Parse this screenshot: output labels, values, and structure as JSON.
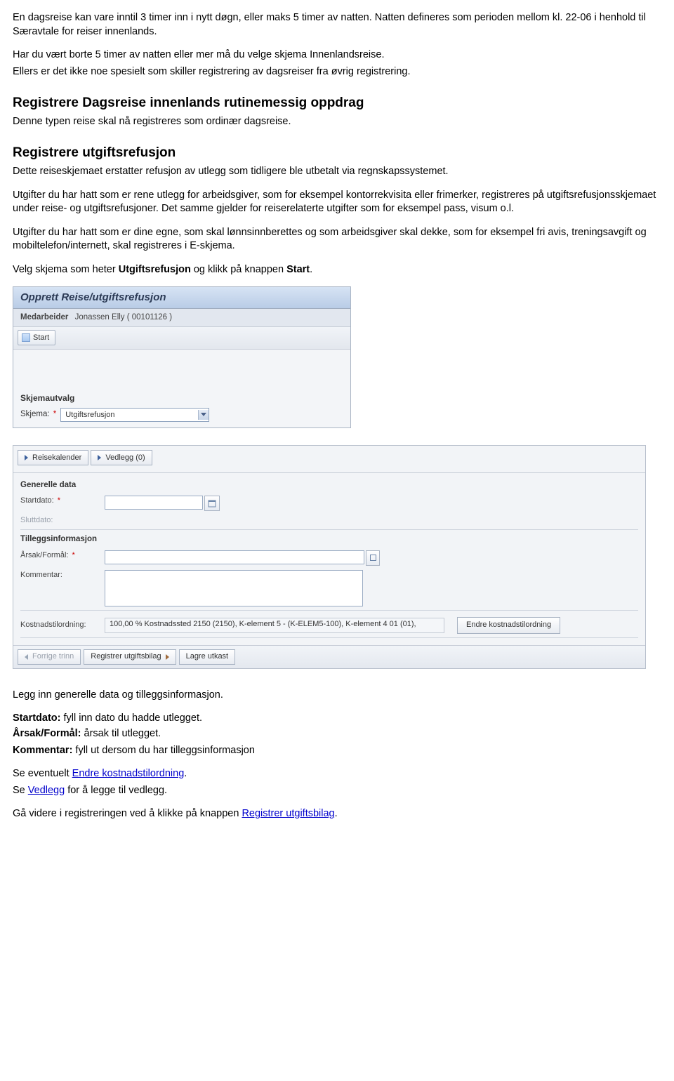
{
  "intro": {
    "p1": "En dagsreise kan vare inntil 3 timer inn i nytt døgn, eller maks 5 timer av natten. Natten defineres som perioden mellom kl. 22-06 i henhold til Særavtale for reiser innenlands.",
    "p2": "Har du vært borte 5 timer av natten eller mer må du velge skjema Innenlandsreise.",
    "p3": "Ellers er det ikke noe spesielt som skiller registrering av dagsreiser fra øvrig registrering."
  },
  "sec1": {
    "title": "Registrere Dagsreise innenlands rutinemessig oppdrag",
    "sub": "Denne typen reise skal nå registreres som ordinær dagsreise."
  },
  "sec2": {
    "title": "Registrere utgiftsrefusjon",
    "p1": "Dette reiseskjemaet erstatter refusjon av utlegg som tidligere ble utbetalt via regnskapssystemet.",
    "p2": "Utgifter du har hatt som er rene utlegg for arbeidsgiver, som for eksempel kontorrekvisita eller frimerker, registreres på utgiftsrefusjonsskjemaet under reise- og utgiftsrefusjoner. Det samme gjelder for reiserelaterte utgifter som for eksempel pass, visum o.l.",
    "p3": "Utgifter du har hatt som er dine egne, som skal lønnsinnberettes og som arbeidsgiver skal dekke, som for eksempel fri avis, treningsavgift og mobiltelefon/internett, skal registreres i E-skjema.",
    "p4_a": "Velg skjema som heter ",
    "p4_b": "Utgiftsrefusjon",
    "p4_c": " og klikk på knappen ",
    "p4_d": "Start",
    "p4_e": "."
  },
  "panel": {
    "title": "Opprett Reise/utgiftsrefusjon",
    "medarbeider_lbl": "Medarbeider",
    "medarbeider_val": "Jonassen Elly ( 00101126 )",
    "start_btn": "Start",
    "section_title": "Skjemautvalg",
    "skjema_lbl": "Skjema:",
    "skjema_val": "Utgiftsrefusjon"
  },
  "form": {
    "btn_reisekalender": "Reisekalender",
    "btn_vedlegg": "Vedlegg (0)",
    "generelle": "Generelle data",
    "startdato": "Startdato:",
    "sluttdato": "Sluttdato:",
    "tillegg": "Tilleggsinformasjon",
    "arsak": "Årsak/Formål:",
    "kommentar": "Kommentar:",
    "kostnad_lbl": "Kostnadstilordning:",
    "kostnad_val": "100,00 % Kostnadssted 2150 (2150), K-element 5 - (K-ELEM5-100), K-element 4 01 (01),",
    "endre_btn": "Endre kostnadstilordning",
    "prev": "Forrige trinn",
    "next": "Registrer utgiftsbilag",
    "save": "Lagre utkast"
  },
  "outro": {
    "p1": "Legg inn generelle data og tilleggsinformasjon.",
    "l1a": "Startdato:",
    "l1b": " fyll inn dato du hadde utlegget.",
    "l2a": "Årsak/Formål:",
    "l2b": " årsak til utlegget.",
    "l3a": "Kommentar:",
    "l3b": " fyll ut dersom du har tilleggsinformasjon",
    "p2a": "Se eventuelt ",
    "p2b": "Endre kostnadstilordning",
    "p2c": ".",
    "p3a": "Se ",
    "p3b": "Vedlegg",
    "p3c": " for å legge til vedlegg.",
    "p4a": "Gå videre i registreringen ved å klikke på knappen ",
    "p4b": "Registrer utgiftsbilag",
    "p4c": "."
  }
}
